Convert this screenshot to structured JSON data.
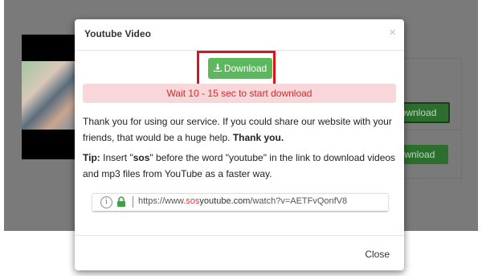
{
  "background": {
    "buttons": [
      "Download",
      "Download"
    ]
  },
  "modal": {
    "title": "Youtube Video",
    "close_x": "×",
    "download_label": "Download",
    "wait_message": "Wait 10 - 15 sec to start download",
    "thanks_text": "Thank you for using our service. If you could share our website with your friends, that would be a huge help.",
    "thanks_bold": "Thank you.",
    "tip_label": "Tip:",
    "tip_pre": "Insert \"",
    "tip_keyword": "sos",
    "tip_post": "\" before the word \"youtube\" in the link to download videos and mp3 files from YouTube as a faster way.",
    "url_prefix": "https://www.",
    "url_highlight": "sos",
    "url_domain": "youtube.com",
    "url_path": "/watch?v=AETFvQonfV8",
    "close_label": "Close"
  },
  "colors": {
    "accent_green": "#5cb85c",
    "alert_bg": "#f8d7da",
    "alert_text": "#d42b2b",
    "highlight_red": "#d9151b"
  }
}
